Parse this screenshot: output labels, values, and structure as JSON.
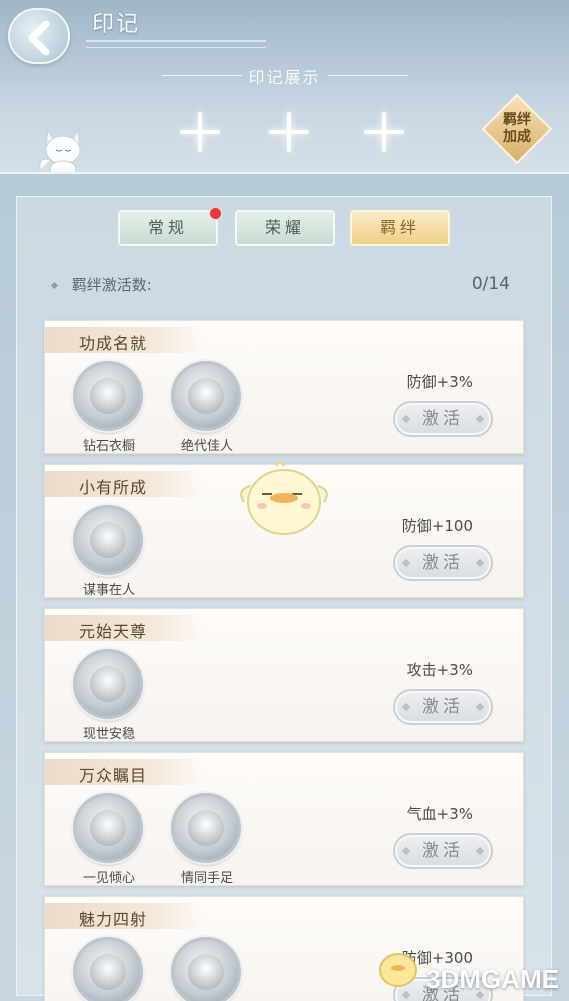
{
  "header": {
    "title": "印记",
    "display_label": "印记展示",
    "bond_bonus_label": "羁绊\n加成"
  },
  "tabs": [
    {
      "label": "常规",
      "active": false,
      "has_notification": true
    },
    {
      "label": "荣耀",
      "active": false,
      "has_notification": false
    },
    {
      "label": "羁绊",
      "active": true,
      "has_notification": false
    }
  ],
  "activation": {
    "label": "羁绊激活数:",
    "value": "0/14"
  },
  "cards": [
    {
      "title": "功成名就",
      "badges": [
        "钻石衣橱",
        "绝代佳人"
      ],
      "stat": "防御+3%",
      "button": "激活"
    },
    {
      "title": "小有所成",
      "badges": [
        "谋事在人"
      ],
      "stat": "防御+100",
      "button": "激活"
    },
    {
      "title": "元始天尊",
      "badges": [
        "现世安稳"
      ],
      "stat": "攻击+3%",
      "button": "激活"
    },
    {
      "title": "万众瞩目",
      "badges": [
        "一见倾心",
        "情同手足"
      ],
      "stat": "气血+3%",
      "button": "激活"
    },
    {
      "title": "魅力四射",
      "badges": [
        "",
        ""
      ],
      "stat": "防御+300",
      "button": "激活"
    }
  ],
  "watermark": "3DMGAME",
  "colors": {
    "tab_active": "#eed08b",
    "tab_normal": "#c9dbd2",
    "notification": "#e33b3b",
    "card_bg": "#fefcf9"
  }
}
